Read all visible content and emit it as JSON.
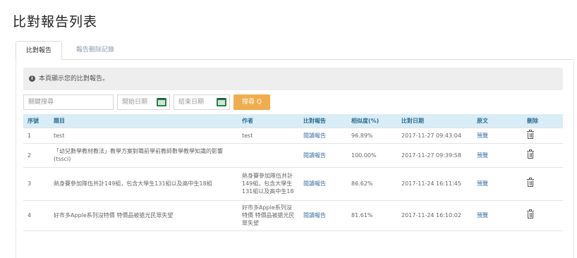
{
  "page": {
    "title": "比對報告列表"
  },
  "tabs": [
    {
      "label": "比對報告"
    },
    {
      "label": "報告刪除記錄"
    }
  ],
  "notice": {
    "icon": "info-icon",
    "text": "本頁顯示您的比對報告。"
  },
  "filters": {
    "keyword_placeholder": "關鍵搜尋",
    "start_date_placeholder": "開始日期",
    "end_date_placeholder": "結束日期",
    "search_label": "搜尋 Q"
  },
  "table": {
    "headers": [
      "序號",
      "題目",
      "作者",
      "比對報告",
      "相似度(%)",
      "比對日期",
      "原文",
      "刪除"
    ],
    "rows": [
      {
        "no": "1",
        "title": "test",
        "author": "test",
        "report": "閱讀報告",
        "similarity": "96.89%",
        "date": "2017-11-27 09:43:04",
        "original": "預覽"
      },
      {
        "no": "2",
        "title": "「幼兒數學教材教法」教學方案對職前學前教師數學教學知識的影響 (tssci)",
        "author": "",
        "report": "閱讀報告",
        "similarity": "100.00%",
        "date": "2017-11-27 09:39:58",
        "original": "預覽"
      },
      {
        "no": "3",
        "title": "熱身賽參加隊伍共計149組，包含大學生131組以及高中生18組",
        "author": "熱身賽參加隊伍共計149組，包含大學生131組以及高中生18",
        "report": "閱讀報告",
        "similarity": "86.62%",
        "date": "2017-11-24 16:11:45",
        "original": "預覽"
      },
      {
        "no": "4",
        "title": "好市多Apple系列沒特價 特價品被搶光民眾失望",
        "author": "好市多Apple系列沒特價 特價品被搶光民眾失望",
        "report": "閱讀報告",
        "similarity": "81.61%",
        "date": "2017-11-24 16:10:02",
        "original": "預覽"
      }
    ]
  }
}
